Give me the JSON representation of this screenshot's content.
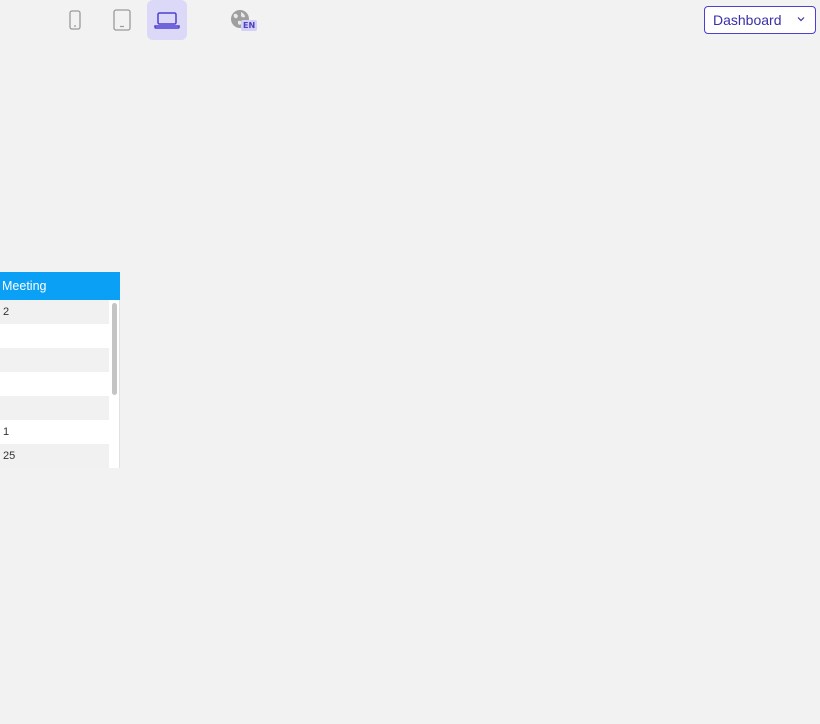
{
  "toolbar": {
    "devices": [
      {
        "name": "mobile",
        "icon": "phone-icon",
        "active": false
      },
      {
        "name": "tablet",
        "icon": "tablet-icon",
        "active": false
      },
      {
        "name": "desktop",
        "icon": "laptop-icon",
        "active": true
      }
    ],
    "language": {
      "icon": "globe-icon",
      "code": "EN"
    },
    "view_select": {
      "selected": "Dashboard",
      "icon": "chevron-down-icon"
    }
  },
  "panel": {
    "header": "Meeting",
    "rows": [
      "2",
      "",
      "",
      "",
      "",
      "1",
      "25"
    ]
  },
  "colors": {
    "accent": "#4c3fd1",
    "header": "#0aa0f5",
    "background": "#f2f2f3"
  }
}
